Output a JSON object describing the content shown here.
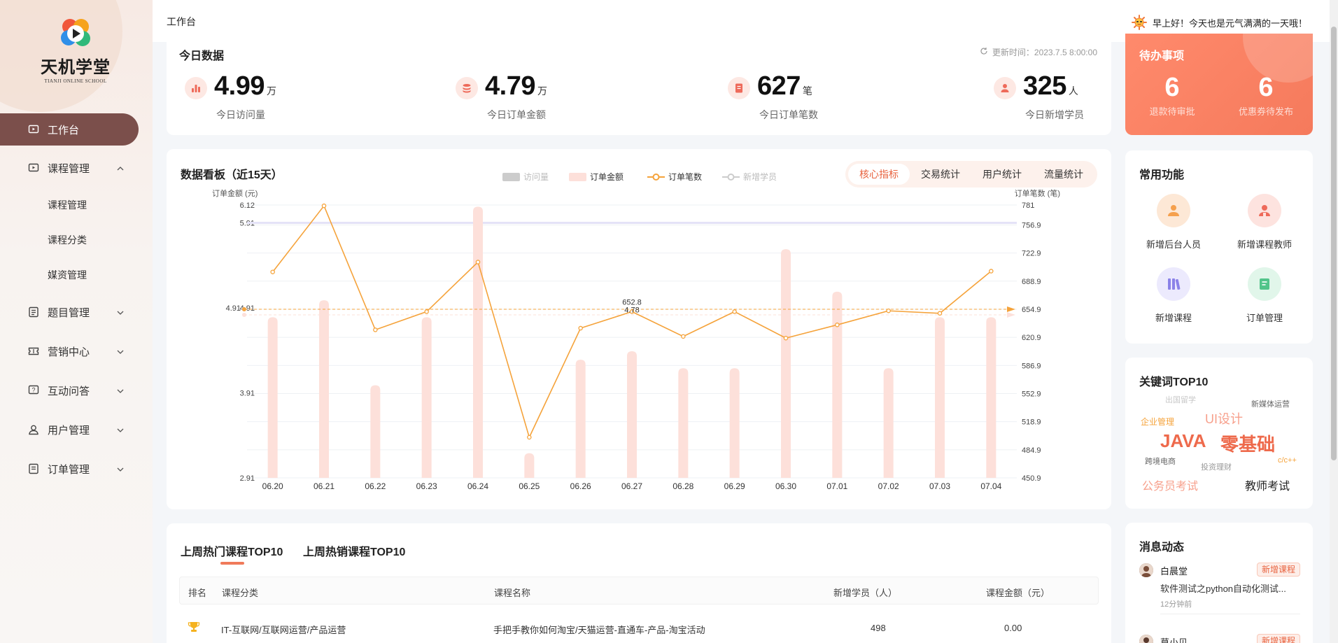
{
  "brand": {
    "name": "天机学堂",
    "subtitle": "TIANJI ONLINE SCHOOL"
  },
  "header": {
    "breadcrumb": "工作台",
    "greeting": "早上好！今天也是元气满满的一天哦！"
  },
  "sidebar": {
    "items": [
      {
        "label": "工作台",
        "icon": "workbench-icon",
        "active": true
      },
      {
        "label": "课程管理",
        "icon": "course-icon",
        "expanded": true,
        "children": [
          "课程管理",
          "课程分类",
          "媒资管理"
        ]
      },
      {
        "label": "题目管理",
        "icon": "question-icon"
      },
      {
        "label": "营销中心",
        "icon": "ticket-icon"
      },
      {
        "label": "互动问答",
        "icon": "qa-icon"
      },
      {
        "label": "用户管理",
        "icon": "user-icon"
      },
      {
        "label": "订单管理",
        "icon": "order-icon"
      }
    ]
  },
  "today": {
    "title": "今日数据",
    "updated": "更新时间：2023.7.5 8:00:00",
    "stats": [
      {
        "value": "4.99",
        "unit": "万",
        "label": "今日访问量",
        "icon": "bar-chart-icon"
      },
      {
        "value": "4.79",
        "unit": "万",
        "label": "今日订单金额",
        "icon": "coins-icon"
      },
      {
        "value": "627",
        "unit": "笔",
        "label": "今日订单笔数",
        "icon": "receipt-icon"
      },
      {
        "value": "325",
        "unit": "人",
        "label": "今日新增学员",
        "icon": "person-icon"
      }
    ]
  },
  "todo": {
    "title": "待办事项",
    "items": [
      {
        "value": "6",
        "label": "退款待审批"
      },
      {
        "value": "6",
        "label": "优惠券待发布"
      }
    ],
    "colors": {
      "background": "#f8826a"
    }
  },
  "dashboard": {
    "title": "数据看板（近15天）",
    "tabs": [
      "核心指标",
      "交易统计",
      "用户统计",
      "流量统计"
    ],
    "active_tab": "核心指标"
  },
  "chart_data": {
    "type": "bar",
    "legend": [
      {
        "name": "访问量",
        "enabled": false,
        "color": "#c8c8c8"
      },
      {
        "name": "订单金额",
        "enabled": true,
        "color": "#fde0da"
      },
      {
        "name": "订单笔数",
        "enabled": true,
        "color": "#f5a33b"
      },
      {
        "name": "新增学员",
        "enabled": false,
        "color": "#c8c8c8"
      }
    ],
    "categories": [
      "06.20",
      "06.21",
      "06.22",
      "06.23",
      "06.24",
      "06.25",
      "06.26",
      "06.27",
      "06.28",
      "06.29",
      "06.30",
      "07.01",
      "07.02",
      "07.03",
      "07.04"
    ],
    "series": [
      {
        "name": "订单金额",
        "axis": "left",
        "type": "bar",
        "color": "#fde0da",
        "values": [
          4.8,
          5.0,
          4.0,
          4.8,
          6.1,
          3.2,
          4.3,
          4.4,
          4.2,
          4.2,
          5.6,
          5.1,
          4.2,
          4.8,
          4.8
        ]
      },
      {
        "name": "订单笔数",
        "axis": "right",
        "type": "line",
        "color": "#f5a33b",
        "values": [
          700,
          780,
          630,
          652,
          712,
          500,
          632,
          652,
          622,
          652,
          620,
          636,
          653,
          650,
          701
        ]
      }
    ],
    "ylabel_left": "订单金额 (元)",
    "ylabel_right": "订单笔数 (笔)",
    "y_left_ticks": [
      "6.12",
      "5.91",
      "4.91",
      "3.91",
      "2.91"
    ],
    "y_left_range": [
      2.91,
      6.12
    ],
    "y_right_ticks": [
      "781",
      "756.9",
      "722.9",
      "688.9",
      "654.9",
      "620.9",
      "586.9",
      "552.9",
      "518.9",
      "484.9",
      "450.9"
    ],
    "y_right_range": [
      450.9,
      781
    ],
    "markline_left": {
      "label": "4.91",
      "value": 4.91
    },
    "markline_right": {
      "value": 654.9
    },
    "tooltip": {
      "category": "06.27",
      "line1": "652.8",
      "line2": "4.78"
    },
    "grid": true
  },
  "functions": {
    "title": "常用功能",
    "items": [
      {
        "label": "新增后台人员",
        "icon": "staff-icon",
        "bg": "#fde8d6",
        "fg": "#f5a04d"
      },
      {
        "label": "新增课程教师",
        "icon": "teacher-icon",
        "bg": "#fde3df",
        "fg": "#ee6a5a"
      },
      {
        "label": "新增课程",
        "icon": "books-icon",
        "bg": "#eceafd",
        "fg": "#8b82e8"
      },
      {
        "label": "订单管理",
        "icon": "order-doc-icon",
        "bg": "#e1f6ea",
        "fg": "#52c48a"
      }
    ]
  },
  "keywords": {
    "title": "关键词TOP10",
    "words": [
      {
        "text": "出国留学",
        "color": "#c8c8c8"
      },
      {
        "text": "新媒体运营",
        "color": "#666666"
      },
      {
        "text": "企业管理",
        "color": "#f5a33b"
      },
      {
        "text": "UI设计",
        "color": "#f7a08c"
      },
      {
        "text": "JAVA",
        "color": "#ee6a4c"
      },
      {
        "text": "零基础",
        "color": "#ee6a4c"
      },
      {
        "text": "跨境电商",
        "color": "#666666"
      },
      {
        "text": "投资理财",
        "color": "#999999"
      },
      {
        "text": "c/c++",
        "color": "#f5a33b"
      },
      {
        "text": "公务员考试",
        "color": "#f7a08c"
      },
      {
        "text": "教师考试",
        "color": "#222222"
      }
    ]
  },
  "hot_courses": {
    "tabs": [
      "上周热门课程TOP10",
      "上周热销课程TOP10"
    ],
    "columns": [
      "排名",
      "课程分类",
      "课程名称",
      "新增学员（人）",
      "课程金额（元）"
    ],
    "rows": [
      {
        "rank_icon": "trophy-icon",
        "category": "IT-互联网/互联网运营/产品运营",
        "name": "手把手教你如何淘宝/天猫运营-直通车-产品-淘宝活动",
        "students": "498",
        "amount": "0.00"
      }
    ]
  },
  "messages": {
    "title": "消息动态",
    "items": [
      {
        "user": "白晨堂",
        "tag": "新增课程",
        "text": "软件测试之python自动化测试...",
        "time": "12分钟前"
      },
      {
        "user": "莫小贝",
        "tag": "新增课程",
        "text": "",
        "time": ""
      }
    ]
  }
}
